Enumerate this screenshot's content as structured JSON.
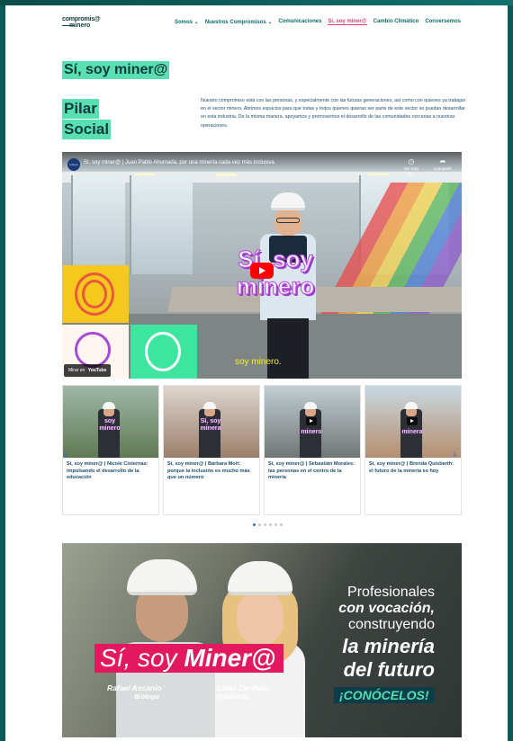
{
  "header": {
    "logo_line1": "compromis@",
    "logo_line2": "minero",
    "nav": [
      "Somos ⌄",
      "Nuestros Compromisos ⌄",
      "Comunicaciones",
      "Sí, soy miner@",
      "Cambio Climático",
      "Conversemos"
    ],
    "active_index": 3
  },
  "main": {
    "title": "Sí, soy miner@",
    "pilar_line1": "Pilar",
    "pilar_line2": "Social",
    "description": "Nuestro compromiso está con las personas, y especialmente con las futuras generaciones, así como con quienes ya trabajan en el sector minero. Abrimos espacios para que todas y todos quienes quieran ser parte de este sector se puedan desarrollar en esta industria. De la misma manera, apoyamos y promovemos el desarrollo de las comunidades cercanas a nuestras operaciones."
  },
  "video": {
    "channel": "minero",
    "title": "Sí, soy miner@ | Juan Pablo Ahumada, por una minería cada vez más inclusiva",
    "watch_later": "Ver más ta...",
    "share": "Compartir",
    "overlay_line1": "Sí, soy",
    "overlay_line2": "minero",
    "subtitle": "soy minero.",
    "watch_on": "Mirar en",
    "youtube": "YouTube"
  },
  "cards": [
    {
      "label": "soy minero",
      "caption": "Sí, soy miner@ | Nicole Cisternas: impulsando el desarrollo de la educación"
    },
    {
      "label": "Sí, soy minera",
      "caption": "Sí, soy miner@ | Bárbara Mori: porque la inclusión es mucho más que un número"
    },
    {
      "label": "minero",
      "caption": "Sí, soy miner@ | Sebastián Morales: las personas en el centro de la minería"
    },
    {
      "label": "minera",
      "caption": "Sí, soy miner@ | Brenda Quisberth: el futuro de la minería es hoy"
    }
  ],
  "carousel": {
    "prev": "‹",
    "next": "›",
    "dots": 6,
    "active_dot": 0
  },
  "banner": {
    "line1": "Profesionales",
    "line2": "con vocación,",
    "line3": "construyendo",
    "line4": "la minería",
    "line5": "del futuro",
    "cta": "¡CONÓCELOS!",
    "soy_prefix": "Sí, soy ",
    "soy_strong": "Miner@",
    "person1_name": "Rafael Ascanio",
    "person1_role": "Biólogo",
    "person2_name": "Lilian Denham",
    "person2_role": "Publicista"
  }
}
